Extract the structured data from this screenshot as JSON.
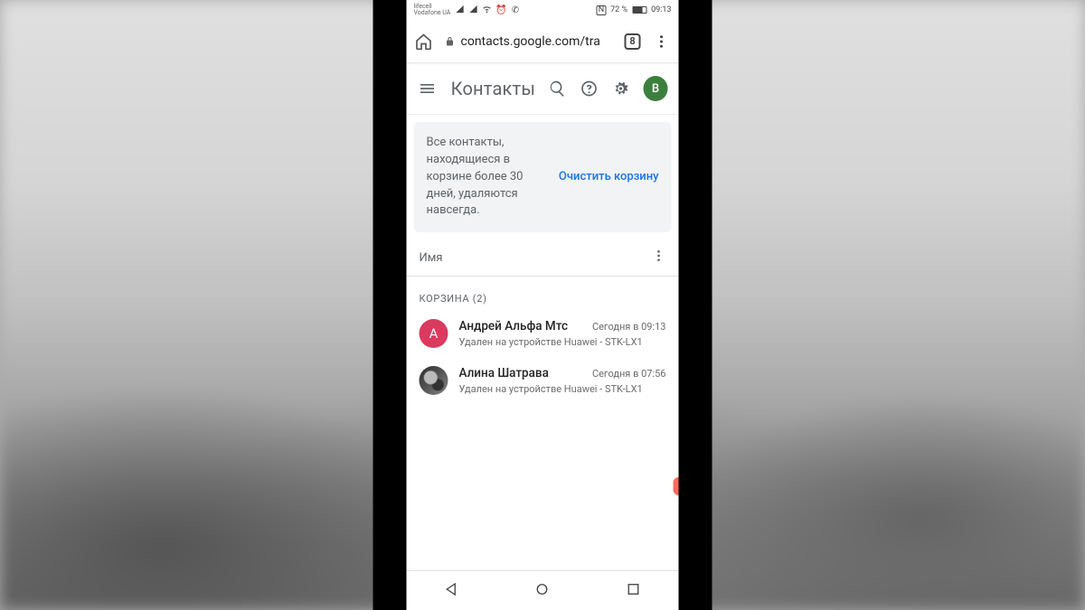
{
  "status": {
    "carrier": "lifecell\nVodafone UA",
    "battery_pct": "72 %",
    "time": "09:13"
  },
  "browser": {
    "url": "contacts.google.com/tra",
    "tab_count": "8"
  },
  "header": {
    "title": "Контакты",
    "avatar_letter": "В"
  },
  "info": {
    "message": "Все контакты, находящиеся в корзине более 30 дней, удаляются навсегда.",
    "action": "Очистить корзину"
  },
  "col_header": {
    "label": "Имя"
  },
  "section": {
    "label": "КОРЗИНА (2)"
  },
  "contacts": [
    {
      "avatar_letter": "А",
      "name": "Андрей Альфа Мтс",
      "time": "Сегодня в 09:13",
      "sub": "Удален на устройстве Huawei - STK-LX1"
    },
    {
      "avatar_letter": "",
      "name": "Алина Шатрава",
      "time": "Сегодня в 07:56",
      "sub": "Удален на устройстве Huawei - STK-LX1"
    }
  ]
}
